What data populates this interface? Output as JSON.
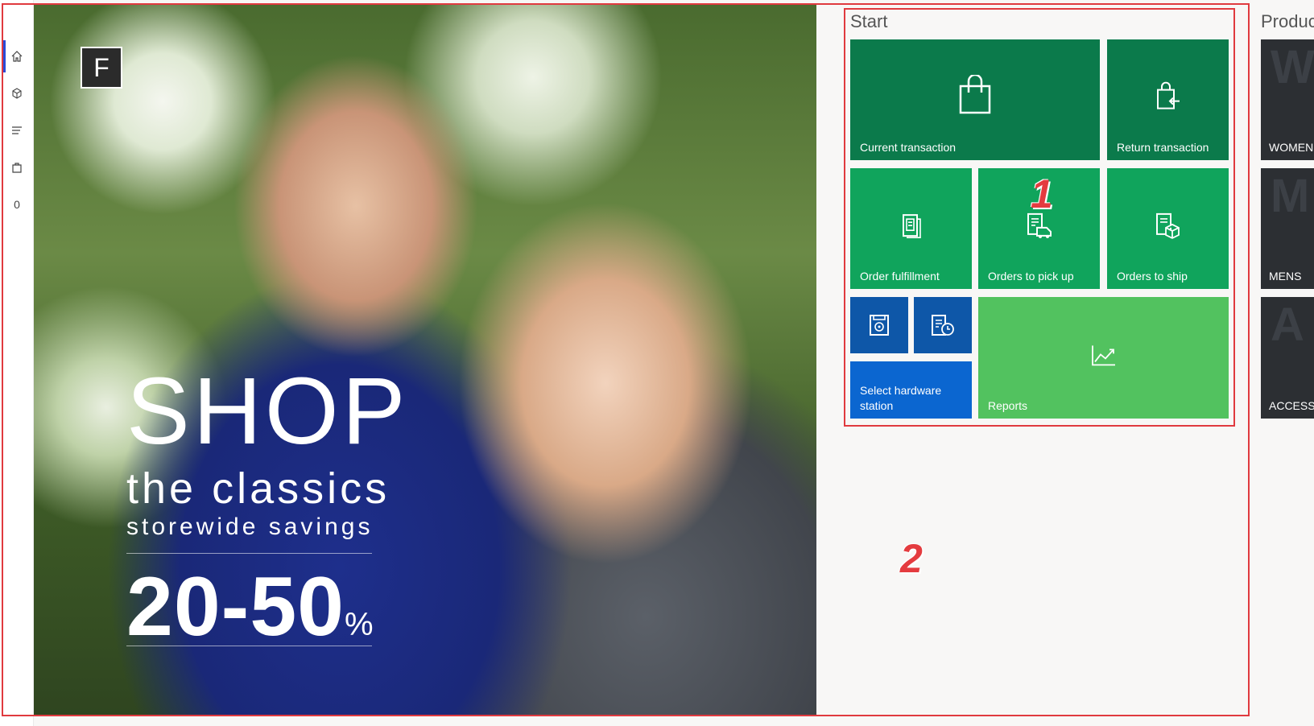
{
  "nav": {
    "items": [
      {
        "name": "home",
        "icon": "home-icon"
      },
      {
        "name": "products",
        "icon": "products-icon"
      },
      {
        "name": "menu",
        "icon": "menu-icon"
      },
      {
        "name": "cart",
        "icon": "shopping-bag-icon"
      }
    ],
    "cart_count": "0"
  },
  "hero": {
    "badge": "F",
    "headline": "SHOP",
    "line2": "the classics",
    "line3": "storewide  savings",
    "discount": "20-50",
    "percent": "%"
  },
  "start": {
    "title": "Start",
    "tiles": {
      "current_transaction": "Current transaction",
      "return_transaction": "Return transaction",
      "order_fulfillment": "Order fulfillment",
      "orders_to_pick_up": "Orders to pick up",
      "orders_to_ship": "Orders to ship",
      "select_hardware_station": "Select hardware station",
      "reports": "Reports"
    }
  },
  "products": {
    "title": "Produc",
    "categories": [
      {
        "letter": "W",
        "label": "WOMENS"
      },
      {
        "letter": "M",
        "label": "MENS"
      },
      {
        "letter": "A",
        "label": "ACCESSO"
      }
    ]
  },
  "annotations": {
    "box1": "1",
    "box2": "2"
  },
  "colors": {
    "tile_dark_green": "#0b7a4b",
    "tile_mid_green": "#10a45c",
    "tile_light_green": "#52c25f",
    "tile_blue_dark": "#0e57a8",
    "tile_blue": "#0b66d0",
    "category_tile": "#2c2f33",
    "annotation_red": "#e03a3f"
  }
}
